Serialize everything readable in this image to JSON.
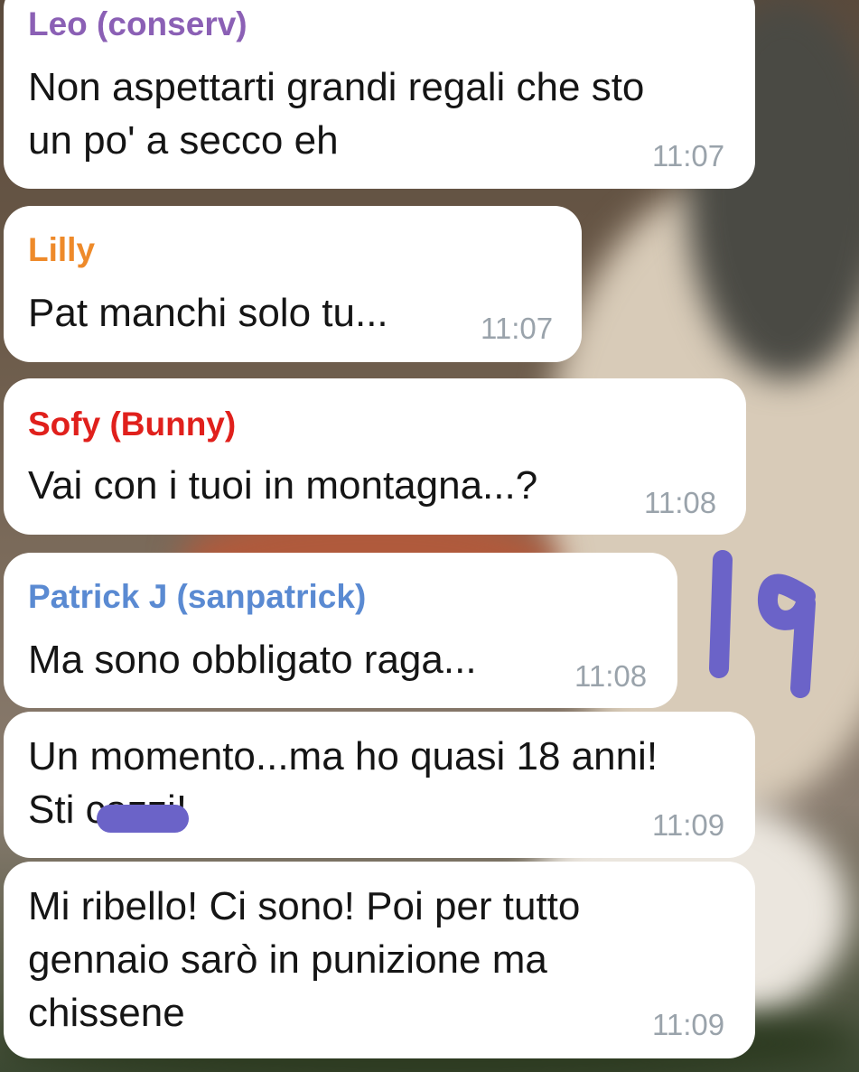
{
  "messages": [
    {
      "sender": "Leo (conserv)",
      "sender_color": "#8b60b5",
      "text": "Non aspettarti grandi regali che sto\nun po' a secco eh",
      "time": "11:07"
    },
    {
      "sender": "Lilly",
      "sender_color": "#ee8a2a",
      "text": "Pat manchi solo tu...",
      "time": "11:07"
    },
    {
      "sender": "Sofy (Bunny)",
      "sender_color": "#e0201c",
      "text": "Vai con i tuoi in montagna...?",
      "time": "11:08"
    },
    {
      "sender": "Patrick J (sanpatrick)",
      "sender_color": "#5a8ad2",
      "text": "Ma sono obbligato raga...",
      "time": "11:08"
    },
    {
      "sender": "",
      "text": "Un momento...ma ho quasi 18 anni!\nSti cazzi!",
      "time": "11:09"
    },
    {
      "sender": "",
      "text": "Mi ribello! Ci sono! Poi per tutto\ngennaio sarò in punizione ma\nchissene",
      "time": "11:09"
    }
  ],
  "annotation": {
    "text": "19",
    "color": "#6b63c8"
  },
  "colors": {
    "bubble": "#ffffff",
    "time": "#9aa3ab",
    "text": "#151515"
  }
}
